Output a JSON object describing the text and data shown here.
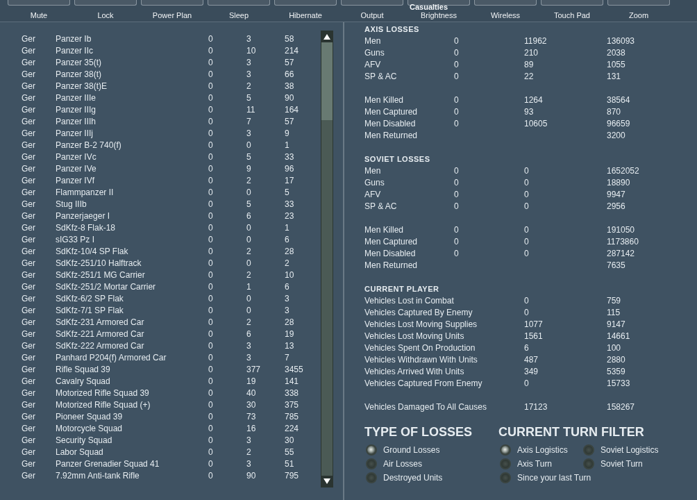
{
  "toolbar": [
    {
      "label": "Mute"
    },
    {
      "label": "Lock"
    },
    {
      "label": "Power Plan"
    },
    {
      "label": "Sleep"
    },
    {
      "label": "Hibernate"
    },
    {
      "label": "Output"
    },
    {
      "label": "Brightness"
    },
    {
      "label": "Wireless"
    },
    {
      "label": "Touch Pad"
    },
    {
      "label": "Zoom"
    }
  ],
  "title": "Casualties",
  "units": [
    {
      "side": "Ger",
      "name": "Panzer Ib",
      "col_1": "0",
      "col_2": "3",
      "col_3": "58"
    },
    {
      "side": "Ger",
      "name": "Panzer IIc",
      "col_1": "0",
      "col_2": "10",
      "col_3": "214"
    },
    {
      "side": "Ger",
      "name": "Panzer 35(t)",
      "col_1": "0",
      "col_2": "3",
      "col_3": "57"
    },
    {
      "side": "Ger",
      "name": "Panzer 38(t)",
      "col_1": "0",
      "col_2": "3",
      "col_3": "66"
    },
    {
      "side": "Ger",
      "name": "Panzer 38(t)E",
      "col_1": "0",
      "col_2": "2",
      "col_3": "38"
    },
    {
      "side": "Ger",
      "name": "Panzer IIIe",
      "col_1": "0",
      "col_2": "5",
      "col_3": "90"
    },
    {
      "side": "Ger",
      "name": "Panzer IIIg",
      "col_1": "0",
      "col_2": "11",
      "col_3": "164"
    },
    {
      "side": "Ger",
      "name": "Panzer IIIh",
      "col_1": "0",
      "col_2": "7",
      "col_3": "57"
    },
    {
      "side": "Ger",
      "name": "Panzer IIIj",
      "col_1": "0",
      "col_2": "3",
      "col_3": "9"
    },
    {
      "side": "Ger",
      "name": "Panzer B-2 740(f)",
      "col_1": "0",
      "col_2": "0",
      "col_3": "1"
    },
    {
      "side": "Ger",
      "name": "Panzer IVc",
      "col_1": "0",
      "col_2": "5",
      "col_3": "33"
    },
    {
      "side": "Ger",
      "name": "Panzer IVe",
      "col_1": "0",
      "col_2": "9",
      "col_3": "96"
    },
    {
      "side": "Ger",
      "name": "Panzer IVf",
      "col_1": "0",
      "col_2": "2",
      "col_3": "17"
    },
    {
      "side": "Ger",
      "name": "Flammpanzer II",
      "col_1": "0",
      "col_2": "0",
      "col_3": "5"
    },
    {
      "side": "Ger",
      "name": "Stug IIIb",
      "col_1": "0",
      "col_2": "5",
      "col_3": "33"
    },
    {
      "side": "Ger",
      "name": "Panzerjaeger I",
      "col_1": "0",
      "col_2": "6",
      "col_3": "23"
    },
    {
      "side": "Ger",
      "name": "SdKfz-8 Flak-18",
      "col_1": "0",
      "col_2": "0",
      "col_3": "1"
    },
    {
      "side": "Ger",
      "name": "sIG33 Pz I",
      "col_1": "0",
      "col_2": "0",
      "col_3": "6"
    },
    {
      "side": "Ger",
      "name": "SdKfz-10/4 SP Flak",
      "col_1": "0",
      "col_2": "2",
      "col_3": "28"
    },
    {
      "side": "Ger",
      "name": "SdKfz-251/10 Halftrack",
      "col_1": "0",
      "col_2": "0",
      "col_3": "2"
    },
    {
      "side": "Ger",
      "name": "SdKfz-251/1 MG Carrier",
      "col_1": "0",
      "col_2": "2",
      "col_3": "10"
    },
    {
      "side": "Ger",
      "name": "SdKfz-251/2 Mortar Carrier",
      "col_1": "0",
      "col_2": "1",
      "col_3": "6"
    },
    {
      "side": "Ger",
      "name": "SdKfz-6/2 SP Flak",
      "col_1": "0",
      "col_2": "0",
      "col_3": "3"
    },
    {
      "side": "Ger",
      "name": "SdKfz-7/1 SP Flak",
      "col_1": "0",
      "col_2": "0",
      "col_3": "3"
    },
    {
      "side": "Ger",
      "name": "SdKfz-231 Armored Car",
      "col_1": "0",
      "col_2": "2",
      "col_3": "28"
    },
    {
      "side": "Ger",
      "name": "SdKfz-221 Armored Car",
      "col_1": "0",
      "col_2": "6",
      "col_3": "19"
    },
    {
      "side": "Ger",
      "name": "SdKfz-222 Armored Car",
      "col_1": "0",
      "col_2": "3",
      "col_3": "13"
    },
    {
      "side": "Ger",
      "name": "Panhard P204(f) Armored Car",
      "col_1": "0",
      "col_2": "3",
      "col_3": "7"
    },
    {
      "side": "Ger",
      "name": "Rifle Squad 39",
      "col_1": "0",
      "col_2": "377",
      "col_3": "3455"
    },
    {
      "side": "Ger",
      "name": "Cavalry Squad",
      "col_1": "0",
      "col_2": "19",
      "col_3": "141"
    },
    {
      "side": "Ger",
      "name": "Motorized Rifle Squad 39",
      "col_1": "0",
      "col_2": "40",
      "col_3": "338"
    },
    {
      "side": "Ger",
      "name": "Motorized Rifle Squad (+)",
      "col_1": "0",
      "col_2": "30",
      "col_3": "375"
    },
    {
      "side": "Ger",
      "name": "Pioneer Squad 39",
      "col_1": "0",
      "col_2": "73",
      "col_3": "785"
    },
    {
      "side": "Ger",
      "name": "Motorcycle Squad",
      "col_1": "0",
      "col_2": "16",
      "col_3": "224"
    },
    {
      "side": "Ger",
      "name": "Security Squad",
      "col_1": "0",
      "col_2": "3",
      "col_3": "30"
    },
    {
      "side": "Ger",
      "name": "Labor Squad",
      "col_1": "0",
      "col_2": "2",
      "col_3": "55"
    },
    {
      "side": "Ger",
      "name": "Panzer Grenadier Squad 41",
      "col_1": "0",
      "col_2": "3",
      "col_3": "51"
    },
    {
      "side": "Ger",
      "name": "7.92mm Anti-tank Rifle",
      "col_1": "0",
      "col_2": "90",
      "col_3": "795"
    }
  ],
  "sections": [
    {
      "title": "AXIS LOSSES",
      "groups": [
        [
          {
            "label": "Men",
            "col_1": "0",
            "col_2": "11962",
            "col_3": "136093"
          },
          {
            "label": "Guns",
            "col_1": "0",
            "col_2": "210",
            "col_3": "2038"
          },
          {
            "label": "AFV",
            "col_1": "0",
            "col_2": "89",
            "col_3": "1055"
          },
          {
            "label": "SP & AC",
            "col_1": "0",
            "col_2": "22",
            "col_3": "131"
          }
        ],
        [
          {
            "label": "Men Killed",
            "col_1": "0",
            "col_2": "1264",
            "col_3": "38564"
          },
          {
            "label": "Men Captured",
            "col_1": "0",
            "col_2": "93",
            "col_3": "870"
          },
          {
            "label": "Men Disabled",
            "col_1": "0",
            "col_2": "10605",
            "col_3": "96659"
          },
          {
            "label": "Men Returned",
            "col_3": "3200"
          }
        ]
      ]
    },
    {
      "title": "SOVIET LOSSES",
      "groups": [
        [
          {
            "label": "Men",
            "col_1": "0",
            "col_2": "0",
            "col_3": "1652052"
          },
          {
            "label": "Guns",
            "col_1": "0",
            "col_2": "0",
            "col_3": "18890"
          },
          {
            "label": "AFV",
            "col_1": "0",
            "col_2": "0",
            "col_3": "9947"
          },
          {
            "label": "SP & AC",
            "col_1": "0",
            "col_2": "0",
            "col_3": "2956"
          }
        ],
        [
          {
            "label": "Men Killed",
            "col_1": "0",
            "col_2": "0",
            "col_3": "191050"
          },
          {
            "label": "Men Captured",
            "col_1": "0",
            "col_2": "0",
            "col_3": "1173860"
          },
          {
            "label": "Men Disabled",
            "col_1": "0",
            "col_2": "0",
            "col_3": "287142"
          },
          {
            "label": "Men Returned",
            "col_3": "7635"
          }
        ]
      ]
    },
    {
      "title": "CURRENT PLAYER",
      "groups": [
        [
          {
            "label": "Vehicles Lost in Combat",
            "col_2": "0",
            "col_3": "759"
          },
          {
            "label": "Vehicles Captured By Enemy",
            "col_2": "0",
            "col_3": "115"
          },
          {
            "label": "Vehicles Lost Moving Supplies",
            "col_2": "1077",
            "col_3": "9147"
          },
          {
            "label": "Vehicles Lost Moving Units",
            "col_2": "1561",
            "col_3": "14661"
          },
          {
            "label": "Vehicles Spent On Production",
            "col_2": "6",
            "col_3": "100"
          },
          {
            "label": "Vehicles Withdrawn With Units",
            "col_2": "487",
            "col_3": "2880"
          },
          {
            "label": "Vehicles Arrived With Units",
            "col_2": "349",
            "col_3": "5359"
          },
          {
            "label": "Vehicles Captured From Enemy",
            "col_2": "0",
            "col_3": "15733"
          }
        ],
        [
          {
            "label": "Vehicles Damaged To All Causes",
            "col_2": "17123",
            "col_3": "158267"
          }
        ]
      ]
    }
  ],
  "type_of_losses": {
    "title": "TYPE OF LOSSES",
    "options": [
      {
        "label": "Ground Losses",
        "selected": true
      },
      {
        "label": "Air Losses",
        "selected": false
      },
      {
        "label": "Destroyed Units",
        "selected": false
      }
    ]
  },
  "turn_filter": {
    "title": "CURRENT TURN FILTER",
    "options": [
      {
        "label": "Axis Logistics",
        "selected": true
      },
      {
        "label": "Soviet Logistics",
        "selected": false
      },
      {
        "label": "Axis Turn",
        "selected": false
      },
      {
        "label": "Soviet Turn",
        "selected": false
      },
      {
        "label": "Since your last Turn",
        "selected": false
      }
    ]
  }
}
